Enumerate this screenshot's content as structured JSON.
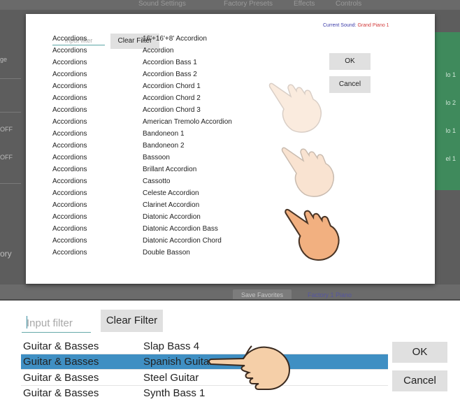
{
  "background": {
    "tabs": [
      "Sound Settings",
      "Factory Presets",
      "Effects",
      "Controls"
    ],
    "left_labels": [
      "ge",
      "OFF",
      "OFF",
      "ory"
    ],
    "right_labels": [
      "lo 1",
      "lo 2",
      "lo 1",
      "el 1"
    ],
    "save_label": "Save Favorites",
    "factory_label": "Factory 1 Piano"
  },
  "dialog": {
    "filter_placeholder": "Input filter",
    "clear_label": "Clear Filter",
    "current_sound_label": "Current Sound:",
    "current_sound_value": "Grand Piano 1",
    "ok_label": "OK",
    "cancel_label": "Cancel",
    "items": [
      {
        "category": "Accordions",
        "name": "16'+16'+8' Accordion"
      },
      {
        "category": "Accordions",
        "name": "Accordion"
      },
      {
        "category": "Accordions",
        "name": "Accordion Bass 1"
      },
      {
        "category": "Accordions",
        "name": "Accordion Bass 2"
      },
      {
        "category": "Accordions",
        "name": "Accordion Chord 1"
      },
      {
        "category": "Accordions",
        "name": "Accordion Chord 2"
      },
      {
        "category": "Accordions",
        "name": "Accordion Chord 3"
      },
      {
        "category": "Accordions",
        "name": "American Tremolo Accordion"
      },
      {
        "category": "Accordions",
        "name": "Bandoneon 1"
      },
      {
        "category": "Accordions",
        "name": "Bandoneon 2"
      },
      {
        "category": "Accordions",
        "name": "Bassoon"
      },
      {
        "category": "Accordions",
        "name": "Brillant Accordion"
      },
      {
        "category": "Accordions",
        "name": "Cassotto"
      },
      {
        "category": "Accordions",
        "name": "Celeste Accordion"
      },
      {
        "category": "Accordions",
        "name": "Clarinet Accordion"
      },
      {
        "category": "Accordions",
        "name": "Diatonic Accordion"
      },
      {
        "category": "Accordions",
        "name": "Diatonic Accordion Bass"
      },
      {
        "category": "Accordions",
        "name": "Diatonic Accordion Chord"
      },
      {
        "category": "Accordions",
        "name": "Double Basson"
      }
    ]
  },
  "zoom": {
    "filter_placeholder": "Input filter",
    "clear_label": "Clear Filter",
    "ok_label": "OK",
    "cancel_label": "Cancel",
    "items": [
      {
        "category": "Guitar & Basses",
        "name": "Slap Bass 4",
        "selected": false
      },
      {
        "category": "Guitar & Basses",
        "name": "Spanish Guitar",
        "selected": true
      },
      {
        "category": "Guitar & Basses",
        "name": "Steel Guitar",
        "selected": false
      },
      {
        "category": "Guitar & Basses",
        "name": "Synth Bass 1",
        "selected": false
      }
    ],
    "selection_color": "#3f8fc3"
  },
  "gesture": {
    "icon": "pointing-hand-icon",
    "steps": [
      "hand-faint-1",
      "hand-faint-2",
      "hand-solid"
    ],
    "hand_color": "#f2c39a"
  }
}
